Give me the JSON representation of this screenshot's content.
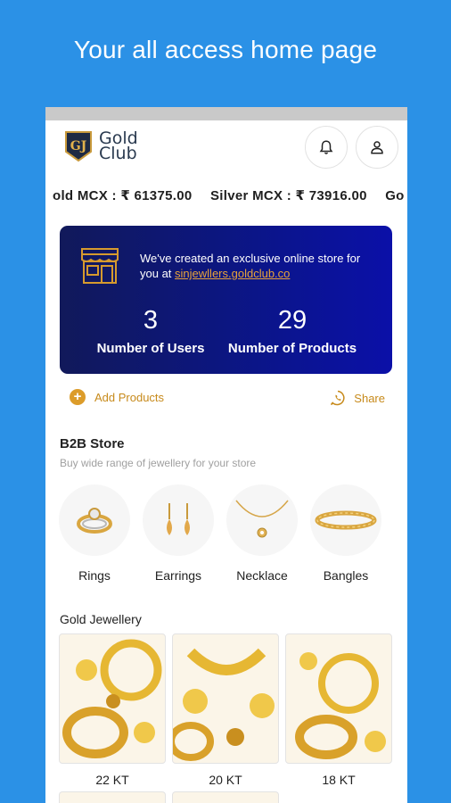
{
  "promo": {
    "title": "Your all access home page"
  },
  "header": {
    "logo_line1": "Gold",
    "logo_line2": "Club",
    "logo_mark": "GJ",
    "icons": [
      "bell-icon",
      "user-icon"
    ]
  },
  "ticker": {
    "items": [
      "old MCX : ₹ 61375.00",
      "Silver MCX : ₹ 73916.00",
      "Go"
    ]
  },
  "banner": {
    "message": "We've created an exclusive online store for you at",
    "link": "sinjewllers.goldclub.co",
    "users_value": "3",
    "users_label": "Number of Users",
    "products_value": "29",
    "products_label": "Number of Products"
  },
  "actions": {
    "add_label": "Add Products",
    "share_label": "Share"
  },
  "b2b": {
    "title": "B2B Store",
    "subtitle": "Buy wide range of jewellery for your store",
    "categories": [
      "Rings",
      "Earrings",
      "Necklace",
      "Bangles"
    ]
  },
  "gold": {
    "title": "Gold Jewellery",
    "tiles": [
      "22 KT",
      "20 KT",
      "18 KT"
    ]
  },
  "colors": {
    "background": "#2b91e6",
    "banner_start": "#11195a",
    "banner_end": "#0b10a8",
    "accent": "#dc9c2a"
  }
}
